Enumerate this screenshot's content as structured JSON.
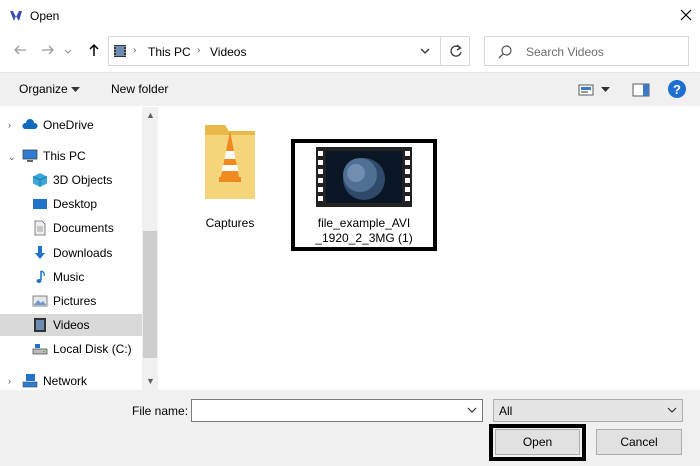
{
  "window": {
    "title": "Open"
  },
  "address": {
    "crumbs": [
      "This PC",
      "Videos"
    ]
  },
  "search": {
    "placeholder": "Search Videos"
  },
  "toolbar": {
    "organize_label": "Organize",
    "new_folder_label": "New folder",
    "help_symbol": "?"
  },
  "sidebar": {
    "items": [
      {
        "label": "OneDrive",
        "icon": "onedrive-cloud-icon"
      },
      {
        "label": "This PC",
        "icon": "computer-icon"
      },
      {
        "label": "3D Objects",
        "icon": "cube-icon"
      },
      {
        "label": "Desktop",
        "icon": "desktop-icon"
      },
      {
        "label": "Documents",
        "icon": "document-icon"
      },
      {
        "label": "Downloads",
        "icon": "download-arrow-icon"
      },
      {
        "label": "Music",
        "icon": "music-note-icon"
      },
      {
        "label": "Pictures",
        "icon": "pictures-icon"
      },
      {
        "label": "Videos",
        "icon": "video-film-icon",
        "selected": true
      },
      {
        "label": "Local Disk (C:)",
        "icon": "drive-icon"
      },
      {
        "label": "Network",
        "icon": "network-icon"
      }
    ]
  },
  "files": [
    {
      "name": "Captures",
      "type": "folder",
      "icon": "vlc-folder-icon"
    },
    {
      "name_line1": "file_example_AVI",
      "name_line2": "_1920_2_3MG (1)",
      "type": "video",
      "icon": "video-thumbnail-icon"
    }
  ],
  "footer": {
    "filename_label": "File name:",
    "filename_value": "",
    "filetype_value": "All",
    "open_label": "Open",
    "cancel_label": "Cancel"
  },
  "colors": {
    "help_blue": "#1f6fd1",
    "selected_bg": "#d9d9d9",
    "toolbar_bg": "#f0f0f0"
  }
}
